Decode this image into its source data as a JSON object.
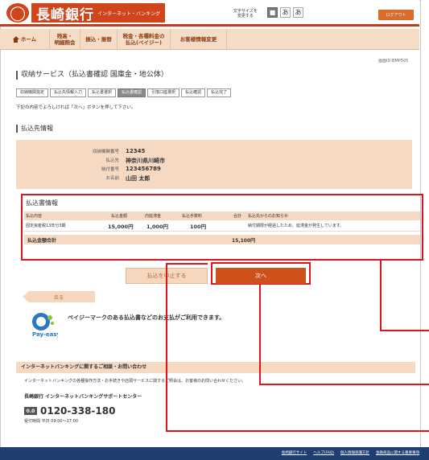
{
  "header": {
    "logo_mark": "◯",
    "bank_name": "長崎銀行",
    "service_name": "インターネット・バンキング",
    "font_size_label": "文字サイズを\n変更する",
    "font_sizes": [
      "■",
      "あ",
      "あ"
    ],
    "logout_label": "ログアウト"
  },
  "nav": {
    "items": [
      "ホーム",
      "残高・\n明細照会",
      "振込・振替",
      "税金・各種料金の\n払込(ペイジー)",
      "お客様情報変更"
    ]
  },
  "screen_id": "画面ID:BMP505",
  "page_title": "収納サービス（払込書確認  国庫金・地公体）",
  "steps": [
    "収納機関指定",
    "払込先情報入力",
    "払込書選択",
    "払込書確認",
    "引落口座選択",
    "払込確認",
    "払込完了"
  ],
  "instruction": "下記の内容でよろしければ「次へ」ボタンを押して下さい。",
  "payee": {
    "section_title": "払込先情報",
    "rows": [
      {
        "label": "収納機関番号",
        "value": "12345"
      },
      {
        "label": "払込先",
        "value": "神奈川県川崎市"
      },
      {
        "label": "納付番号",
        "value": "123456789"
      },
      {
        "label": "お名前",
        "value": "山田  太郎"
      }
    ]
  },
  "bill": {
    "section_title": "払込書情報",
    "headers": {
      "content": "払込内容",
      "amount": "払込金額",
      "late_fee": "内延滞金",
      "fee": "払込手数料",
      "total": "合計",
      "notice": "払込先からのお知らせ"
    },
    "row": {
      "content": "固定資産税13年分3期",
      "amount": "15,000円",
      "late_fee": "1,000円",
      "fee": "100円",
      "total": "",
      "notice": "納付期限が経過したため、延滞金が発生しています。"
    },
    "total_label": "払込金額合計",
    "total_value": "15,100円"
  },
  "buttons": {
    "cancel": "払込を中止する",
    "next": "次へ",
    "back": "戻る"
  },
  "payeasy": {
    "logo_text": "Pay-easy",
    "message": "ペイジーマークのある払込書などのお支払がご利用できます。"
  },
  "contact": {
    "heading": "インターネットバンキングに関するご相談・お問い合わせ",
    "note": "インターネットバンキングの各種操作方法・お手続きや店頭サービスに関するご照会は、お客様のお問い合わせください。",
    "center_name": "長崎銀行  インターネットバンキングサポートセンター",
    "phone_icon": "0.0",
    "phone": "0120-338-180",
    "hours": "受付時間 平日  09:00～17:00"
  },
  "footer": {
    "links": [
      "長崎銀行サイト",
      "ヘルプ(FAQ)",
      "個人情報保護方針",
      "金融商品に関する重要事項"
    ]
  },
  "colors": {
    "brand": "#d0451b",
    "nav_bg": "#f4dcc7",
    "highlight": "#e0141a",
    "footer": "#1f3f70"
  }
}
